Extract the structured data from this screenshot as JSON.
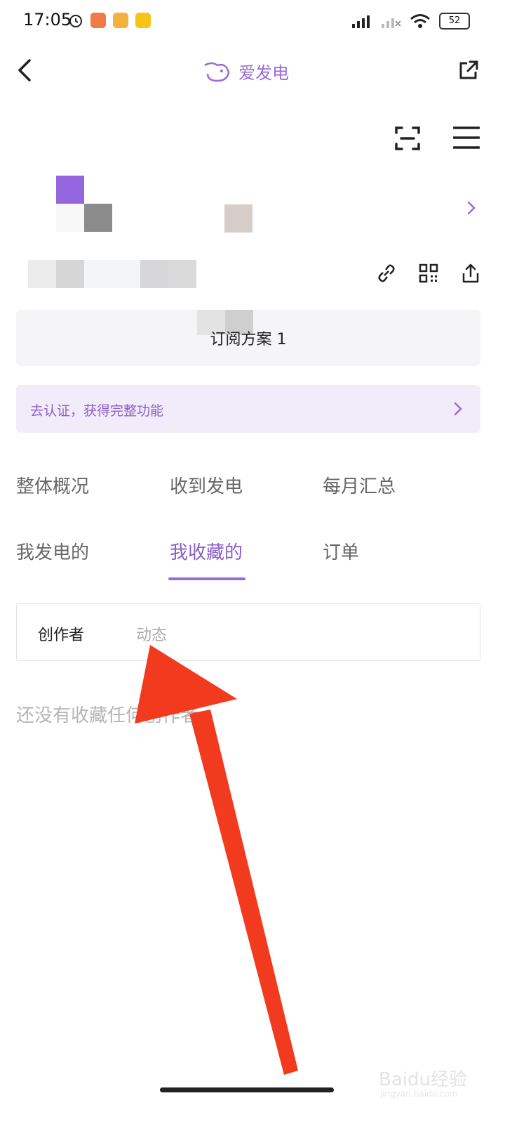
{
  "status_bar": {
    "time": "17:05",
    "battery": "52",
    "icons": [
      "alarm-icon",
      "app-notification-icon",
      "weibo-icon",
      "app-icon",
      "hd-signal-icon",
      "signal-off-icon",
      "wifi-icon"
    ]
  },
  "header": {
    "title": "爱发电",
    "brand_color": "#9b6bd6"
  },
  "plan_card": {
    "label": "订阅方案 1"
  },
  "verify_banner": {
    "text": "去认证，获得完整功能"
  },
  "nav": {
    "items": [
      {
        "label": "整体概况"
      },
      {
        "label": "收到发电"
      },
      {
        "label": "每月汇总"
      },
      {
        "label": "我发电的"
      },
      {
        "label": "我收藏的"
      },
      {
        "label": "订单"
      }
    ],
    "active_index": 4
  },
  "subtabs": {
    "creator": "创作者",
    "feed": "动态"
  },
  "empty_state": {
    "text": "还没有收藏任何创作者"
  },
  "watermark": {
    "text": "Baidu经验",
    "sub": "jingyan.baidu.com"
  },
  "colors": {
    "accent": "#9b6bd6",
    "annotation_arrow": "#f23a1e",
    "banner_bg": "#f2ecfa"
  }
}
